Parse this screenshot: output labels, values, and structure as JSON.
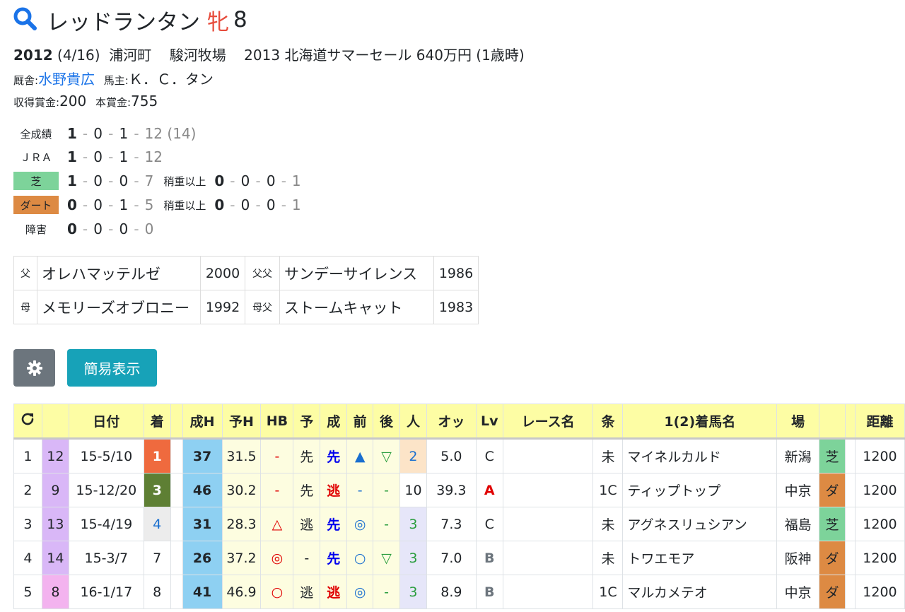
{
  "header": {
    "name": "レッドランタン",
    "sex": "牝",
    "age": "8"
  },
  "profile": {
    "birth_year": "2012",
    "birth_date": "(4/16)",
    "location": "浦河町",
    "breeder": "駿河牧場",
    "sale": "2013 北海道サマーセール 640万円 (1歳時)",
    "trainer_label": "厩舎:",
    "trainer": "水野貴広",
    "owner_label": "馬主:",
    "owner": "Ｋ．Ｃ．タン",
    "earned_label": "収得賞金:",
    "earned": "200",
    "prize_label": "本賞金:",
    "prize": "755"
  },
  "records": {
    "all": {
      "label": "全成績",
      "w": "1",
      "s": "0",
      "t": "1",
      "o": "12",
      "extra": "(14)"
    },
    "jra": {
      "label": "ＪＲＡ",
      "w": "1",
      "s": "0",
      "t": "1",
      "o": "12"
    },
    "turf": {
      "label": "芝",
      "w": "1",
      "s": "0",
      "t": "0",
      "o": "7",
      "sub_label": "稍重以上",
      "sw": "0",
      "ss": "0",
      "st": "0",
      "so": "1"
    },
    "dirt": {
      "label": "ダート",
      "w": "0",
      "s": "0",
      "t": "1",
      "o": "5",
      "sub_label": "稍重以上",
      "sw": "0",
      "ss": "0",
      "st": "0",
      "so": "1"
    },
    "hurdle": {
      "label": "障害",
      "w": "0",
      "s": "0",
      "t": "0",
      "o": "0"
    }
  },
  "pedigree": {
    "sire_label": "父",
    "sire": "オレハマッテルゼ",
    "sire_year": "2000",
    "sire_sire_label": "父父",
    "sire_sire": "サンデーサイレンス",
    "sire_sire_year": "1986",
    "dam_label": "母",
    "dam": "メモリーズオブロニー",
    "dam_year": "1992",
    "dam_sire_label": "母父",
    "dam_sire": "ストームキャット",
    "dam_sire_year": "1983"
  },
  "buttons": {
    "settings_icon": "gear-icon",
    "simple_view": "簡易表示"
  },
  "table": {
    "headers": [
      "",
      "",
      "日付",
      "着",
      "",
      "成H",
      "予H",
      "HB",
      "予",
      "成",
      "前",
      "後",
      "人",
      "オッ",
      "Lv",
      "レース名",
      "条",
      "1(2)着馬名",
      "場",
      "",
      "",
      "距離"
    ],
    "refresh_icon": "refresh-icon",
    "rows": [
      {
        "no": "1",
        "w": "12",
        "date": "15-5/10",
        "fin": "1",
        "h": "37",
        "yh": "31.5",
        "hb": "-",
        "yo": "先",
        "sei": "先",
        "mae": "▲",
        "ato": "▽",
        "pop": "2",
        "odds": "5.0",
        "lv": "C",
        "race": "",
        "cond": "未",
        "horse": "マイネルカルド",
        "place": "新潟",
        "surf": "芝",
        "dist": "1200"
      },
      {
        "no": "2",
        "w": "9",
        "date": "15-12/20",
        "fin": "3",
        "h": "46",
        "yh": "30.2",
        "hb": "-",
        "yo": "先",
        "sei": "逃",
        "mae": "-",
        "ato": "-",
        "pop": "10",
        "odds": "39.3",
        "lv": "A",
        "race": "",
        "cond": "1C",
        "horse": "ティップトップ",
        "place": "中京",
        "surf": "ダ",
        "dist": "1200"
      },
      {
        "no": "3",
        "w": "13",
        "date": "15-4/19",
        "fin": "4",
        "h": "31",
        "yh": "28.3",
        "hb": "△",
        "yo": "逃",
        "sei": "先",
        "mae": "◎",
        "ato": "-",
        "pop": "3",
        "odds": "7.3",
        "lv": "C",
        "race": "",
        "cond": "未",
        "horse": "アグネスリュシアン",
        "place": "福島",
        "surf": "芝",
        "dist": "1200"
      },
      {
        "no": "4",
        "w": "14",
        "date": "15-3/7",
        "fin": "7",
        "h": "26",
        "yh": "37.2",
        "hb": "◎",
        "yo": "-",
        "sei": "先",
        "mae": "○",
        "ato": "▽",
        "pop": "3",
        "odds": "7.0",
        "lv": "B",
        "race": "",
        "cond": "未",
        "horse": "トワエモア",
        "place": "阪神",
        "surf": "ダ",
        "dist": "1200"
      },
      {
        "no": "5",
        "w": "8",
        "date": "16-1/17",
        "fin": "8",
        "h": "41",
        "yh": "46.9",
        "hb": "○",
        "yo": "逃",
        "sei": "逃",
        "mae": "◎",
        "ato": "-",
        "pop": "3",
        "odds": "8.9",
        "lv": "B",
        "race": "",
        "cond": "1C",
        "horse": "マルカメテオ",
        "place": "中京",
        "surf": "ダ",
        "dist": "1200"
      }
    ]
  }
}
